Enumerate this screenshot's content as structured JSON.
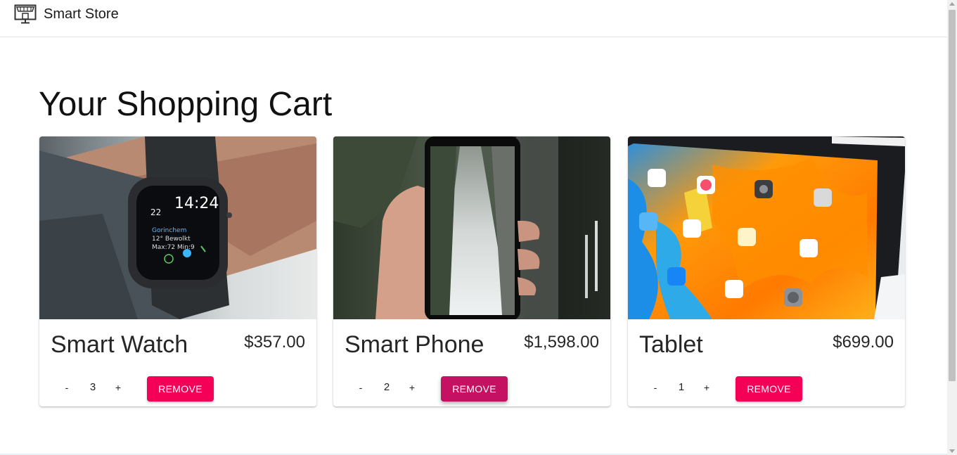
{
  "app": {
    "brand": "Smart Store",
    "logo_icon": "store-icon"
  },
  "page": {
    "title": "Your Shopping Cart"
  },
  "cart": {
    "items": [
      {
        "name": "Smart Watch",
        "price": "$357.00",
        "quantity": "3",
        "minus_label": "-",
        "plus_label": "+",
        "remove_label": "REMOVE",
        "image_icon": "smart-watch-image"
      },
      {
        "name": "Smart Phone",
        "price": "$1,598.00",
        "quantity": "2",
        "minus_label": "-",
        "plus_label": "+",
        "remove_label": "REMOVE",
        "image_icon": "smart-phone-image"
      },
      {
        "name": "Tablet",
        "price": "$699.00",
        "quantity": "1",
        "minus_label": "-",
        "plus_label": "+",
        "remove_label": "REMOVE",
        "image_icon": "tablet-image"
      }
    ]
  },
  "colors": {
    "accent": "#f50057",
    "accent_hover": "#c51162"
  }
}
